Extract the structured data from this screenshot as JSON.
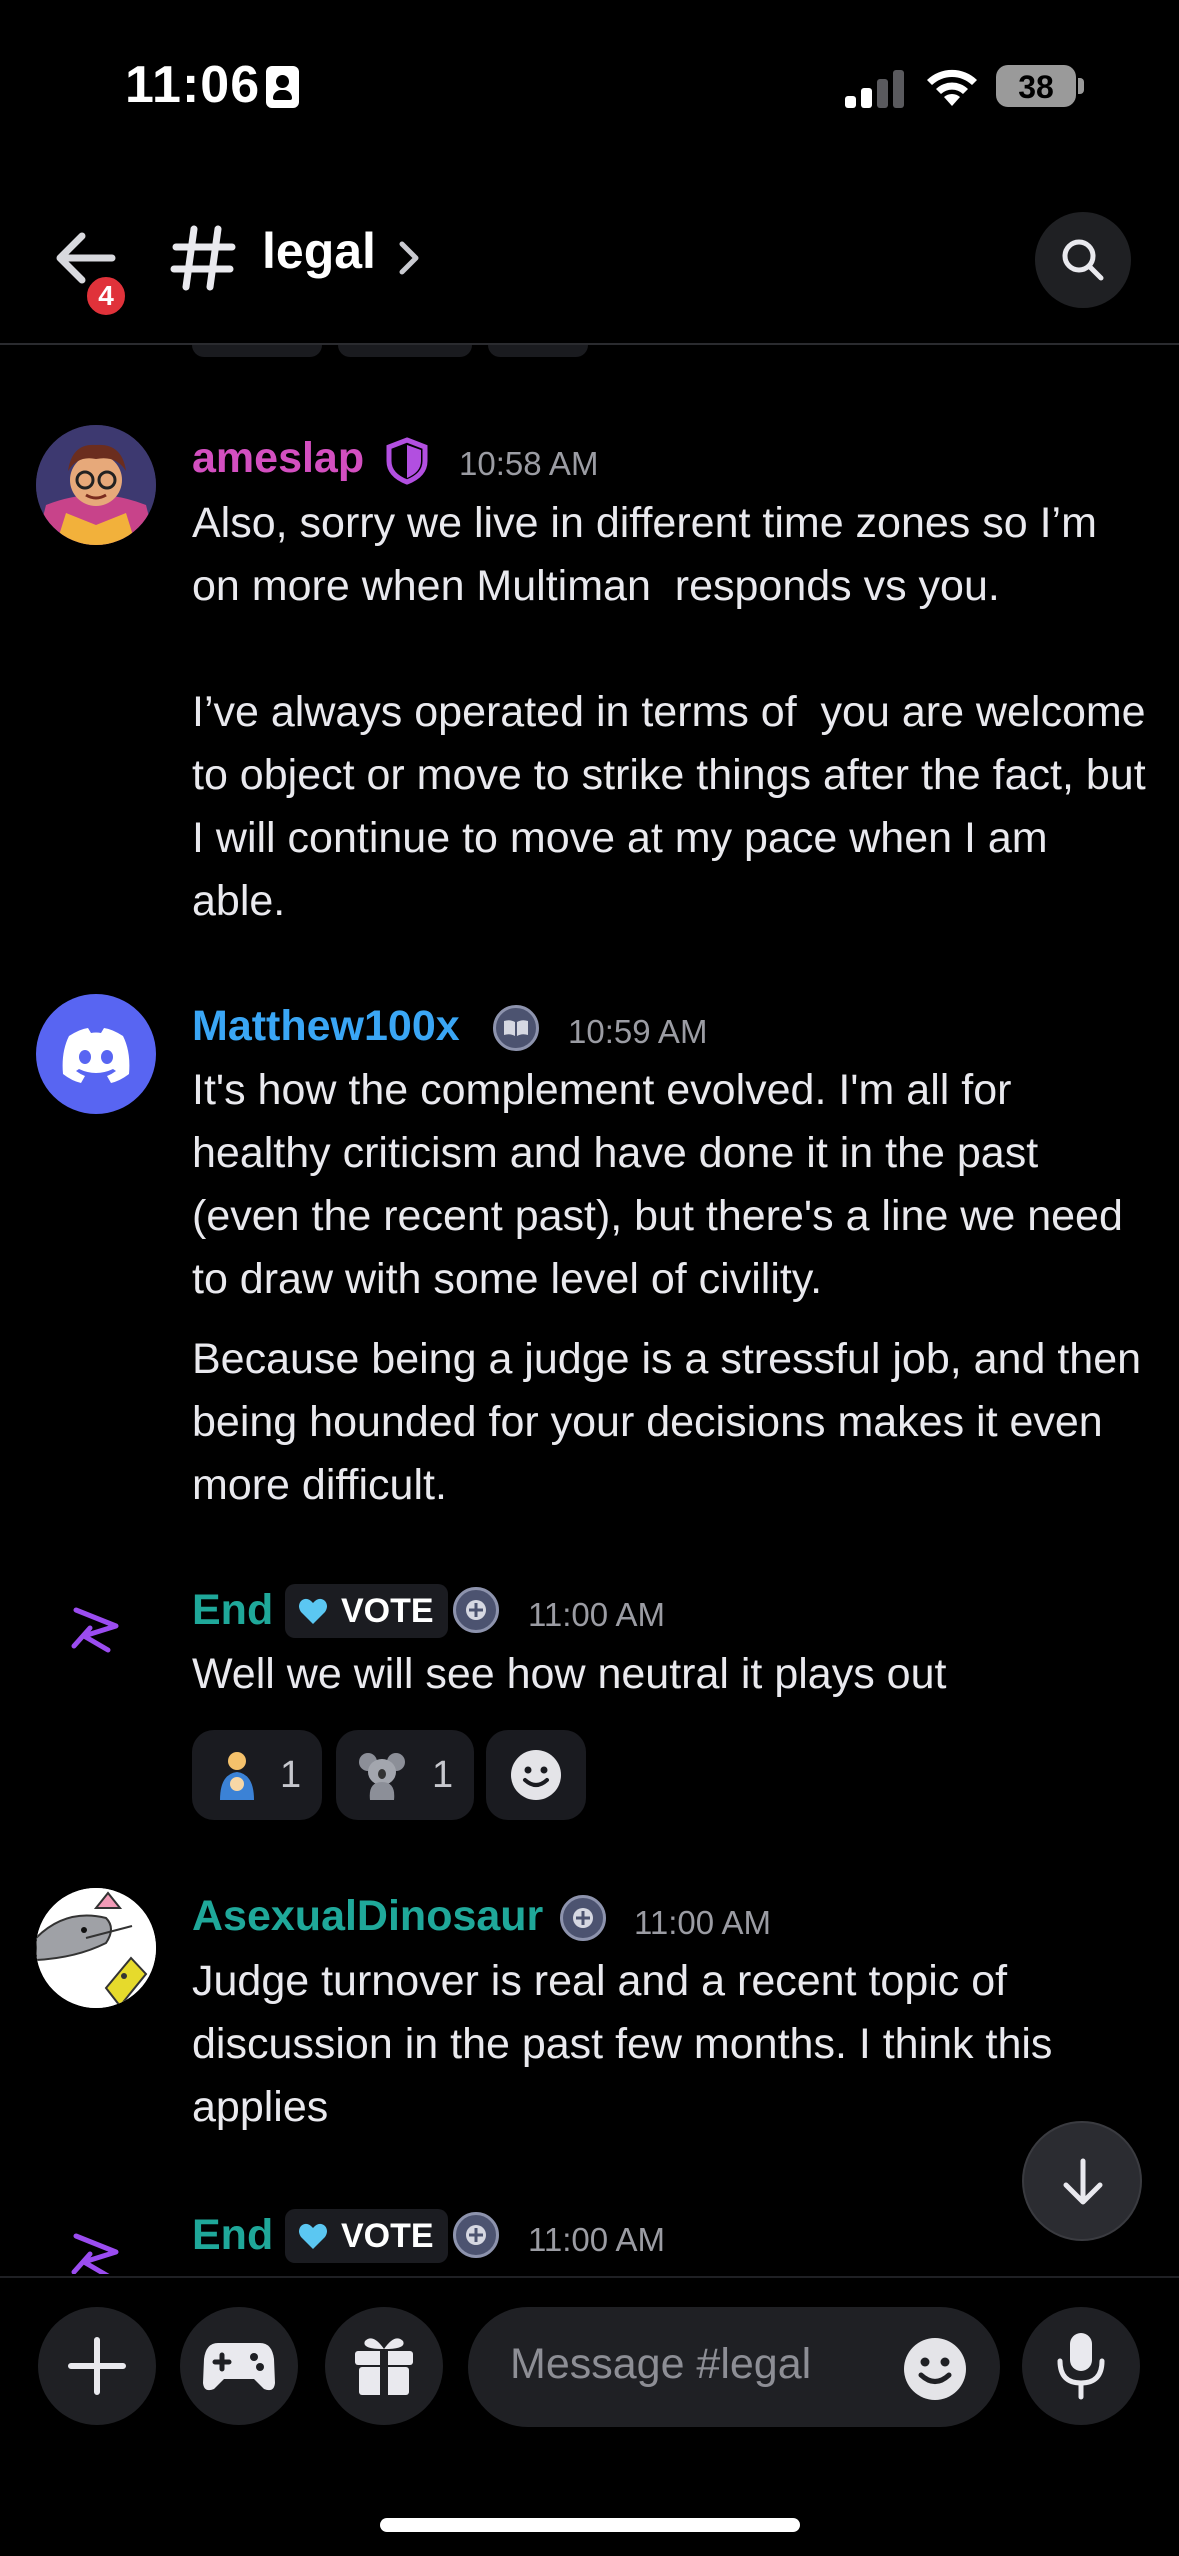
{
  "status_bar": {
    "time": "11:06",
    "battery": "38"
  },
  "header": {
    "unread_count": "4",
    "channel_name": "legal"
  },
  "messages": [
    {
      "author": "ameslap",
      "author_color": "#d34fc0",
      "time": "10:58 AM",
      "text": "Also, sorry we live in different time zones so I’m on more when Multiman  responds vs you.\n\nI’ve always operated in terms of  you are welcome to object or move to strike things after the fact, but I will continue to move at my pace when I am able."
    },
    {
      "author": "Matthew100x",
      "author_color": "#3aa6f5",
      "time": "10:59 AM",
      "text": "It's how the complement evolved. I'm all for healthy criticism and have done it in the past (even the recent past), but there's a line we need to draw with some level of civility.",
      "text2": "Because being a judge is a stressful job, and then being hounded for your decisions makes it even more difficult."
    },
    {
      "author": "End",
      "author_color": "#1fa89a",
      "tag": "VOTE",
      "time": "11:00 AM",
      "text": "Well we will see how neutral it plays out",
      "reactions": [
        {
          "emoji": "person-holding-baby",
          "count": "1"
        },
        {
          "emoji": "koala",
          "count": "1"
        }
      ]
    },
    {
      "author": "AsexualDinosaur",
      "author_color": "#1fa89a",
      "time": "11:00 AM",
      "text": "Judge turnover is real and a recent topic of discussion in the past few months. I think this applies"
    },
    {
      "author": "End",
      "author_color": "#1fa89a",
      "tag": "VOTE",
      "time": "11:00 AM"
    }
  ],
  "composer": {
    "placeholder": "Message #legal"
  }
}
